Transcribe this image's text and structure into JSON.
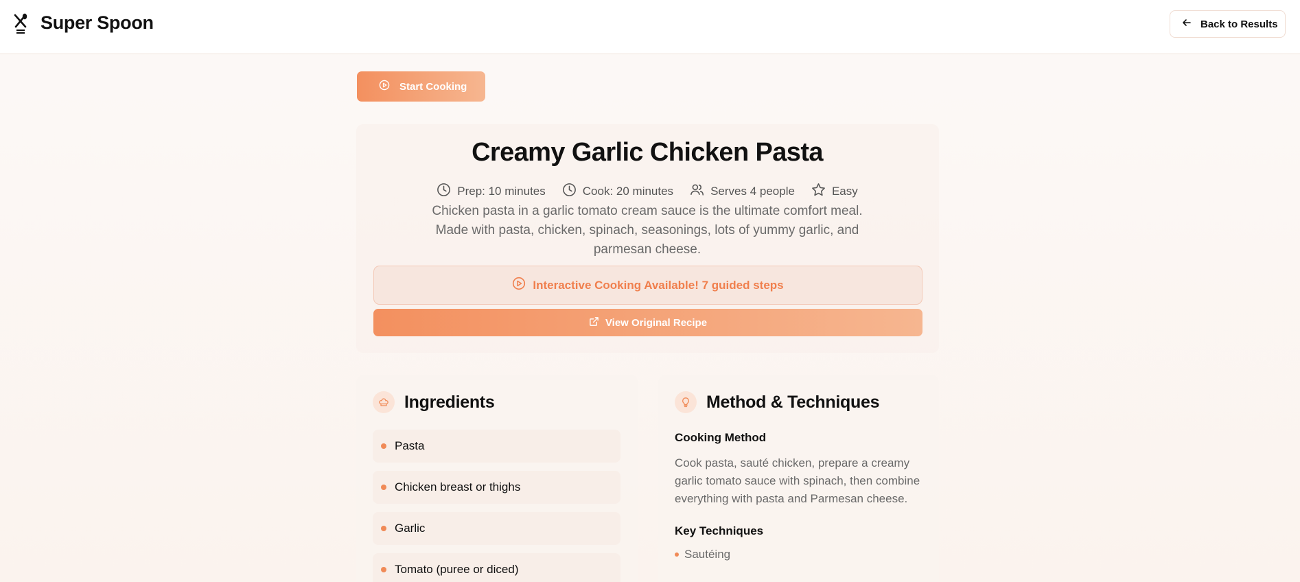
{
  "header": {
    "app_title": "Super Spoon",
    "back_label": "Back to Results"
  },
  "actions": {
    "start_cooking_label": "Start Cooking",
    "view_original_label": "View Original Recipe"
  },
  "recipe": {
    "title": "Creamy Garlic Chicken Pasta",
    "meta": [
      {
        "icon": "clock-icon",
        "label": "Prep: 10 minutes"
      },
      {
        "icon": "clock-icon",
        "label": "Cook: 20 minutes"
      },
      {
        "icon": "users-icon",
        "label": "Serves 4 people"
      },
      {
        "icon": "star-icon",
        "label": "Easy"
      }
    ],
    "description": "Chicken pasta in a garlic tomato cream sauce is the ultimate comfort meal. Made with pasta, chicken, spinach, seasonings, lots of yummy garlic, and parmesan cheese.",
    "interactive_banner": "Interactive Cooking Available! 7 guided steps"
  },
  "ingredients": {
    "title": "Ingredients",
    "items": [
      "Pasta",
      "Chicken breast or thighs",
      "Garlic",
      "Tomato (puree or diced)"
    ]
  },
  "method": {
    "title": "Method & Techniques",
    "cooking_method_heading": "Cooking Method",
    "cooking_method_text": "Cook pasta, sauté chicken, prepare a creamy garlic tomato sauce with spinach, then combine everything with pasta and Parmesan cheese.",
    "key_techniques_heading": "Key Techniques",
    "techniques": [
      "Sautéing"
    ]
  },
  "colors": {
    "accent": "#f3905f",
    "accent_light": "#f6b690",
    "banner_text": "#f07f4d"
  }
}
